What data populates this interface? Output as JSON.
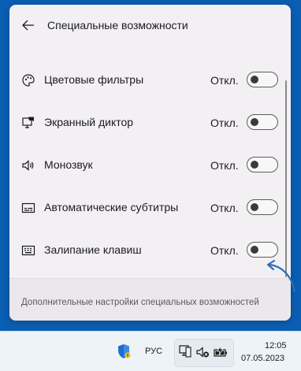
{
  "panel": {
    "title": "Специальные возможности",
    "back_icon": "arrow-left-icon",
    "items": [
      {
        "icon": "palette-icon",
        "label": "Цветовые фильтры",
        "state": "Откл.",
        "on": false
      },
      {
        "icon": "narrator-icon",
        "label": "Экранный диктор",
        "state": "Откл.",
        "on": false
      },
      {
        "icon": "mono-audio-icon",
        "label": "Монозвук",
        "state": "Откл.",
        "on": false
      },
      {
        "icon": "captions-icon",
        "label": "Автоматические субтитры",
        "state": "Откл.",
        "on": false
      },
      {
        "icon": "sticky-keys-icon",
        "label": "Залипание клавиш",
        "state": "Откл.",
        "on": false
      }
    ],
    "footer_link": "Дополнительные настройки специальных возможностей"
  },
  "taskbar": {
    "language": "РУС",
    "time": "12:05",
    "date": "07.05.2023",
    "icons": [
      "security-shield-icon",
      "network-icon",
      "volume-muted-icon",
      "battery-charging-icon"
    ]
  },
  "colors": {
    "desktop": "#0a5fb4",
    "panel": "#f3f0f4",
    "annotation_arrow": "#2d6fb5"
  }
}
